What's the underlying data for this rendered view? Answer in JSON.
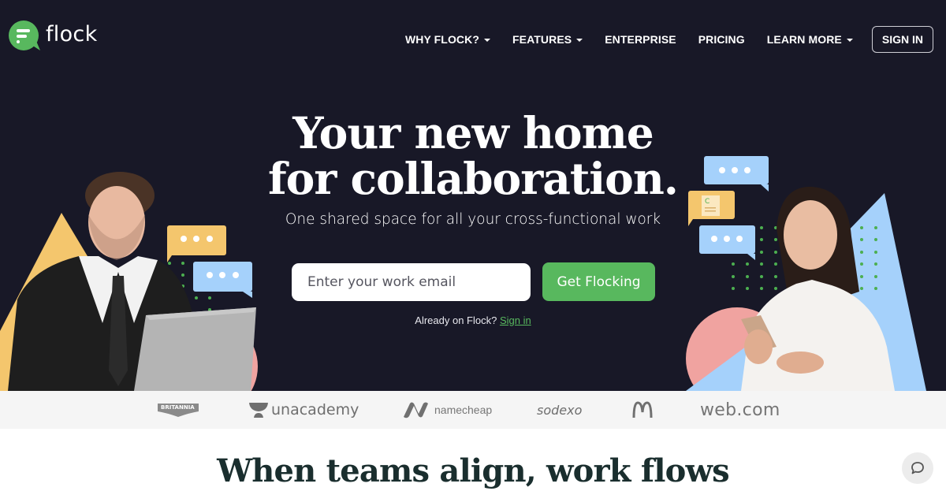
{
  "brand": {
    "name": "flock",
    "accent_color": "#58b85e",
    "hero_bg": "#181827"
  },
  "nav": {
    "items": [
      {
        "label": "WHY FLOCK?",
        "has_dropdown": true
      },
      {
        "label": "FEATURES",
        "has_dropdown": true
      },
      {
        "label": "ENTERPRISE",
        "has_dropdown": false
      },
      {
        "label": "PRICING",
        "has_dropdown": false
      },
      {
        "label": "LEARN MORE",
        "has_dropdown": true
      }
    ],
    "signin_label": "SIGN IN"
  },
  "hero": {
    "title_line1": "Your new home",
    "title_line2": "for collaboration.",
    "subtitle": "One shared space for all your cross-functional work",
    "email_placeholder": "Enter your work email",
    "email_value": "",
    "cta_label": "Get Flocking",
    "already_text": "Already on Flock?",
    "signin_link": "Sign in"
  },
  "customer_logos": [
    {
      "name": "BRITANNIA"
    },
    {
      "name": "unacademy"
    },
    {
      "name": "namecheap"
    },
    {
      "name": "sodexo"
    },
    {
      "name": "McDonald's",
      "glyph": "M"
    },
    {
      "name": "web.com"
    }
  ],
  "section": {
    "title": "When teams align, work flows"
  },
  "chat_widget": {
    "icon": "chat-bubble-icon"
  }
}
